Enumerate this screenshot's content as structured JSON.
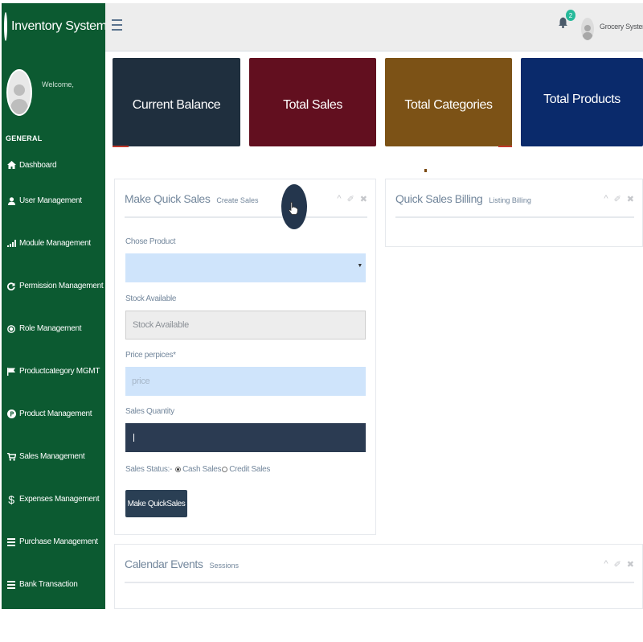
{
  "sidebar": {
    "brand_title": "Inventory System",
    "welcome": "Welcome,",
    "section": "GENERAL",
    "items": [
      {
        "label": "Dashboard",
        "icon": "home-icon"
      },
      {
        "label": "User Management",
        "icon": "user-icon"
      },
      {
        "label": "Module Management",
        "icon": "bar-chart-icon"
      },
      {
        "label": "Permission Management",
        "icon": "refresh-icon"
      },
      {
        "label": "Role Management",
        "icon": "circle-dot-icon"
      },
      {
        "label": "Productcategory MGMT",
        "icon": "flag-icon"
      },
      {
        "label": "Product Management",
        "icon": "p-circle-icon"
      },
      {
        "label": "Sales Management",
        "icon": "cart-icon"
      },
      {
        "label": "Expenses Management",
        "icon": "dollar-icon"
      },
      {
        "label": "Purchase Management",
        "icon": "list-icon"
      },
      {
        "label": "Bank Transaction",
        "icon": "list-icon"
      }
    ]
  },
  "topbar": {
    "notification_count": "2",
    "user_name": "Grocery System"
  },
  "tiles": [
    {
      "label": "Current Balance",
      "color": "#1f2f3e"
    },
    {
      "label": "Total Sales",
      "color": "#620f1f"
    },
    {
      "label": "Total Categories",
      "color": "#7c5216"
    },
    {
      "label": "Total Products",
      "color": "#0a2a6b"
    }
  ],
  "quick_sales": {
    "title": "Make Quick Sales",
    "subtitle": "Create Sales",
    "product_label": "Chose Product",
    "product_value": "",
    "stock_label": "Stock Available",
    "stock_placeholder": "Stock Available",
    "price_label": "Price perpices*",
    "price_placeholder": "price",
    "qty_label": "Sales Quantity",
    "qty_value": "",
    "status_label": "Sales Status:-",
    "status_options": [
      "Cash Sales",
      "Credit Sales"
    ],
    "status_selected": "Cash Sales",
    "submit_label": "Make QuickSales"
  },
  "billing": {
    "title": "Quick Sales Billing",
    "subtitle": "Listing Billing"
  },
  "calendar": {
    "title": "Calendar Events",
    "subtitle": "Sessions"
  },
  "colors": {
    "sidebar": "#0c5a31",
    "accent_button": "#2a3f54",
    "badge": "#26b99a"
  }
}
